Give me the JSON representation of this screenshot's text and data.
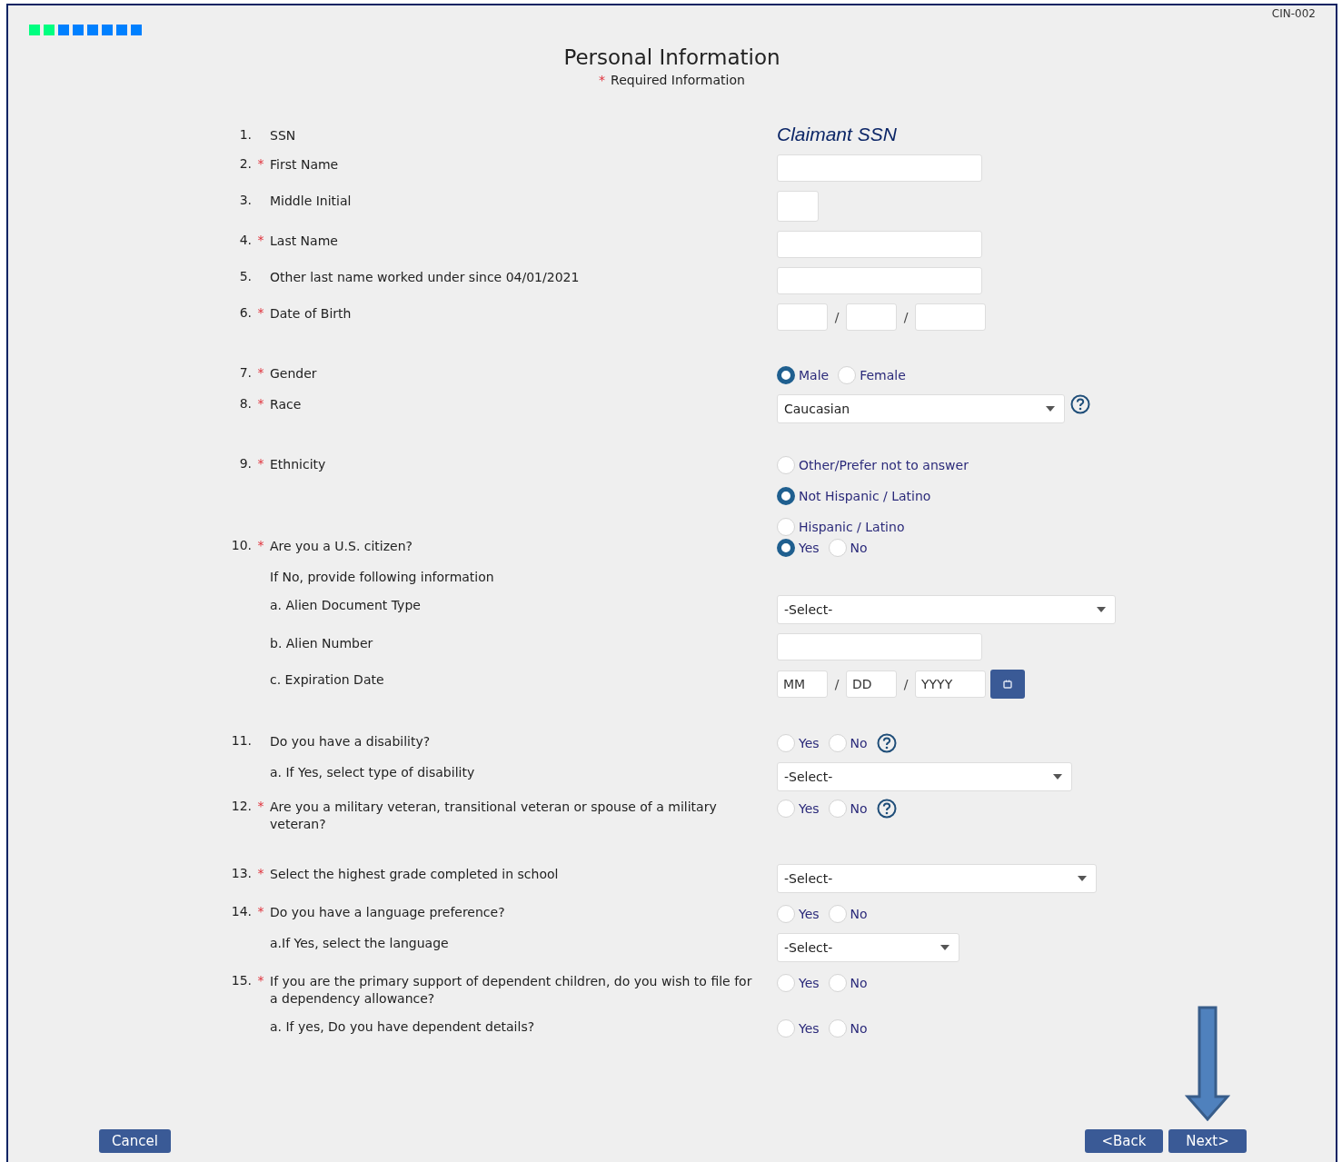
{
  "page_code": "CIN-002",
  "progress": [
    {
      "color": "#00ff80"
    },
    {
      "color": "#00ff80"
    },
    {
      "color": "#0080ff"
    },
    {
      "color": "#0080ff"
    },
    {
      "color": "#0080ff"
    },
    {
      "color": "#0080ff"
    },
    {
      "color": "#0080ff"
    },
    {
      "color": "#0080ff"
    }
  ],
  "title": "Personal Information",
  "required_note": {
    "marker": "*",
    "text": "Required Information"
  },
  "questions": [
    {
      "number": "1.",
      "label": "SSN",
      "control": {
        "kind": "text",
        "value": "Claimant SSN"
      }
    },
    {
      "number": "2.",
      "marker": "*",
      "label": "First Name",
      "control": {
        "kind": "field"
      }
    },
    {
      "number": "3.",
      "label": "Middle Initial",
      "control": {
        "kind": "initial"
      }
    },
    {
      "number": "4.",
      "marker": "*",
      "label": "Last Name",
      "control": {
        "kind": "field"
      }
    },
    {
      "number": "5.",
      "label": "Other last name worked under since 04/01/2021",
      "control": {
        "kind": "field"
      }
    },
    {
      "number": "6.",
      "marker": "*",
      "label": "Date of Birth",
      "control": {
        "kind": "date",
        "separator": "/",
        "parts": [
          {
            "kind": "month"
          },
          {
            "kind": "day"
          },
          {
            "kind": "year"
          }
        ]
      }
    },
    {
      "number": "7.",
      "marker": "*",
      "label": "Gender",
      "control": {
        "kind": "radios",
        "options": [
          {
            "label": "Male",
            "selected": true
          },
          {
            "label": "Female",
            "selected": false
          }
        ]
      }
    },
    {
      "number": "8.",
      "marker": "*",
      "label": "Race",
      "control": {
        "kind": "select",
        "value": "Caucasian",
        "help": true
      }
    },
    {
      "number": "9.",
      "marker": "*",
      "label": "Ethnicity",
      "control": {
        "kind": "radio-list",
        "options": [
          {
            "label": "Other/Prefer not to answer",
            "selected": false
          },
          {
            "label": "Not Hispanic / Latino",
            "selected": true
          },
          {
            "label": "Hispanic / Latino",
            "selected": false
          }
        ]
      }
    },
    {
      "number": "10.",
      "marker": "*",
      "label": "Are you a U.S. citizen?",
      "control": {
        "kind": "radios",
        "options": [
          {
            "label": "Yes",
            "selected": true
          },
          {
            "label": "No",
            "selected": false
          }
        ]
      }
    },
    {
      "label": "If No, provide following information",
      "control": {
        "kind": "none"
      }
    },
    {
      "label": "a. Alien Document Type",
      "control": {
        "kind": "select",
        "value": "-Select-"
      }
    },
    {
      "label": "b. Alien Number",
      "control": {
        "kind": "field"
      }
    },
    {
      "label": "c. Expiration Date",
      "control": {
        "kind": "date",
        "separator": "/",
        "calendar": true,
        "parts": [
          {
            "kind": "month",
            "placeholder": "MM"
          },
          {
            "kind": "day",
            "placeholder": "DD"
          },
          {
            "kind": "year",
            "placeholder": "YYYY"
          }
        ]
      }
    },
    {
      "number": "11.",
      "label": "Do you have a disability?",
      "control": {
        "kind": "radios",
        "help": true,
        "options": [
          {
            "label": "Yes",
            "selected": false
          },
          {
            "label": "No",
            "selected": false
          }
        ]
      }
    },
    {
      "label": "a. If Yes, select type of disability",
      "control": {
        "kind": "select",
        "value": "-Select-"
      }
    },
    {
      "number": "12.",
      "marker": "*",
      "label": "Are you a military veteran, transitional veteran or spouse of a military veteran?",
      "control": {
        "kind": "radios",
        "help": true,
        "options": [
          {
            "label": "Yes",
            "selected": false
          },
          {
            "label": "No",
            "selected": false
          }
        ]
      }
    },
    {
      "number": "13.",
      "marker": "*",
      "label": "Select the highest grade completed in school",
      "control": {
        "kind": "select",
        "value": "-Select-"
      }
    },
    {
      "number": "14.",
      "marker": "*",
      "label": "Do you have a language preference?",
      "control": {
        "kind": "radios",
        "options": [
          {
            "label": "Yes",
            "selected": false
          },
          {
            "label": "No",
            "selected": false
          }
        ]
      }
    },
    {
      "label": "a.If Yes, select the language",
      "control": {
        "kind": "select",
        "value": "-Select-"
      }
    },
    {
      "number": "15.",
      "marker": "*",
      "label": "If you are the primary support of dependent children, do you wish to file for a dependency allowance?",
      "control": {
        "kind": "radios",
        "options": [
          {
            "label": "Yes",
            "selected": false
          },
          {
            "label": "No",
            "selected": false
          }
        ]
      }
    },
    {
      "label": "a. If yes, Do you have dependent details?",
      "control": {
        "kind": "radios",
        "options": [
          {
            "label": "Yes",
            "selected": false
          },
          {
            "label": "No",
            "selected": false
          }
        ]
      }
    }
  ],
  "annotation": {
    "kind": "arrow"
  },
  "buttons_left": [
    {
      "label": "Cancel"
    }
  ],
  "buttons_right": [
    {
      "label": "<Back"
    },
    {
      "label": "Next>"
    }
  ]
}
